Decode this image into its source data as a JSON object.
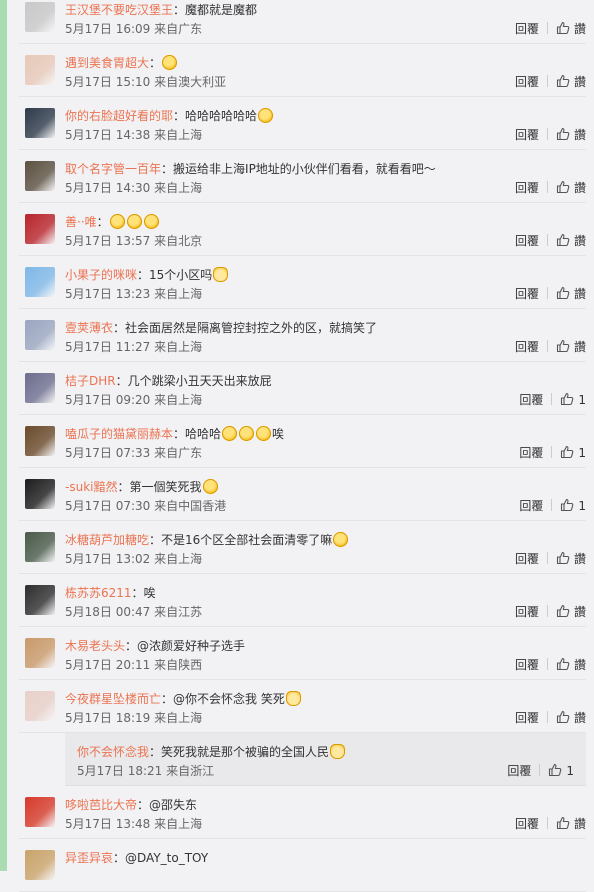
{
  "comments": [
    {
      "user": "王汉堡不要吃汉堡王",
      "text": "魔都就是魔都",
      "emojis": [],
      "date": "5月17日 16:09",
      "loc": "来自广东",
      "reply": "回覆",
      "like": "讚"
    },
    {
      "user": "遇到美食胃超大",
      "text": "",
      "emojis": [
        "laugh-cry"
      ],
      "date": "5月17日 15:10",
      "loc": "来自澳大利亚",
      "reply": "回覆",
      "like": "讚"
    },
    {
      "user": "你的右脸超好看的耶",
      "text": "哈哈哈哈哈哈",
      "emojis": [
        "grin"
      ],
      "date": "5月17日 14:38",
      "loc": "来自上海",
      "reply": "回覆",
      "like": "讚"
    },
    {
      "user": "取个名字管一百年",
      "text": "搬运给非上海IP地址的小伙伴们看看，就看看吧～",
      "emojis": [],
      "date": "5月17日 14:30",
      "loc": "来自上海",
      "reply": "回覆",
      "like": "讚"
    },
    {
      "user": "善··唯",
      "text": "",
      "emojis": [
        "grin",
        "grin",
        "grin"
      ],
      "date": "5月17日 13:57",
      "loc": "来自北京",
      "reply": "回覆",
      "like": "讚"
    },
    {
      "user": "小果子的咪咪",
      "text": "15个小区吗",
      "emojis": [
        "cat"
      ],
      "date": "5月17日 13:23",
      "loc": "来自上海",
      "reply": "回覆",
      "like": "讚"
    },
    {
      "user": "壹荚薄衣",
      "text": "社会面居然是隔离管控封控之外的区，就搞笑了",
      "emojis": [],
      "date": "5月17日 11:27",
      "loc": "来自上海",
      "reply": "回覆",
      "like": "讚"
    },
    {
      "user": "桔子DHR",
      "text": "几个跳梁小丑天天出来放屁",
      "emojis": [],
      "date": "5月17日 09:20",
      "loc": "来自上海",
      "reply": "回覆",
      "like": "1"
    },
    {
      "user": "嗑瓜子的猫黛丽赫本",
      "text": "哈哈哈",
      "emojis": [
        "laugh-cry",
        "laugh-cry",
        "laugh-cry"
      ],
      "text2": "唉",
      "date": "5月17日 07:33",
      "loc": "来自广东",
      "reply": "回覆",
      "like": "1"
    },
    {
      "user": "-suki黯然",
      "text": "第一個笑死我",
      "emojis": [
        "laugh-cry"
      ],
      "date": "5月17日 07:30",
      "loc": "来自中国香港",
      "reply": "回覆",
      "like": "1"
    },
    {
      "user": "冰糖葫芦加糖吃",
      "text": "不是16个区全部社会面清零了嘛",
      "emojis": [
        "think"
      ],
      "date": "5月17日 13:02",
      "loc": "来自上海",
      "reply": "回覆",
      "like": "讚"
    },
    {
      "user": "栋苏苏6211",
      "text": "唉",
      "emojis": [],
      "date": "5月18日 00:47",
      "loc": "来自江苏",
      "reply": "回覆",
      "like": "讚"
    },
    {
      "user": "木易老头头",
      "text": "@浓颜爱好种子选手",
      "emojis": [],
      "date": "5月17日 20:11",
      "loc": "来自陕西",
      "reply": "回覆",
      "like": "讚"
    },
    {
      "user": "今夜群星坠楼而亡",
      "text": "@你不会怀念我 笑死",
      "emojis": [
        "cat"
      ],
      "date": "5月17日 18:19",
      "loc": "来自上海",
      "reply": "回覆",
      "like": "讚"
    }
  ],
  "sub_reply": {
    "user": "你不会怀念我",
    "text": "笑死我就是那个被骗的全国人民",
    "emojis": [
      "cat"
    ],
    "date": "5月17日 18:21",
    "loc": "来自浙江",
    "reply": "回覆",
    "like": "1"
  },
  "comments_after": [
    {
      "user": "哆啦芭比大帝",
      "text": "@邵失东",
      "emojis": [],
      "date": "5月17日 13:48",
      "loc": "来自上海",
      "reply": "回覆",
      "like": "讚"
    },
    {
      "user": "异歪异哀",
      "text": "@DAY_to_TOY",
      "emojis": [],
      "date": "",
      "loc": "",
      "reply": "",
      "like": ""
    }
  ],
  "avatar_colors": [
    "#c8c8c8",
    "#e7c9b8",
    "#2e3a4a",
    "#5b5040",
    "#b8242a",
    "#7fb8e8",
    "#9aa6c0",
    "#6d6e8e",
    "#6a4a2a",
    "#1c1c1c",
    "#4a5a4a",
    "#2d2d2d",
    "#c99a6a",
    "#e8d0c8",
    "#d63a2a",
    "#caa46a"
  ],
  "sub_avatar_none": true
}
